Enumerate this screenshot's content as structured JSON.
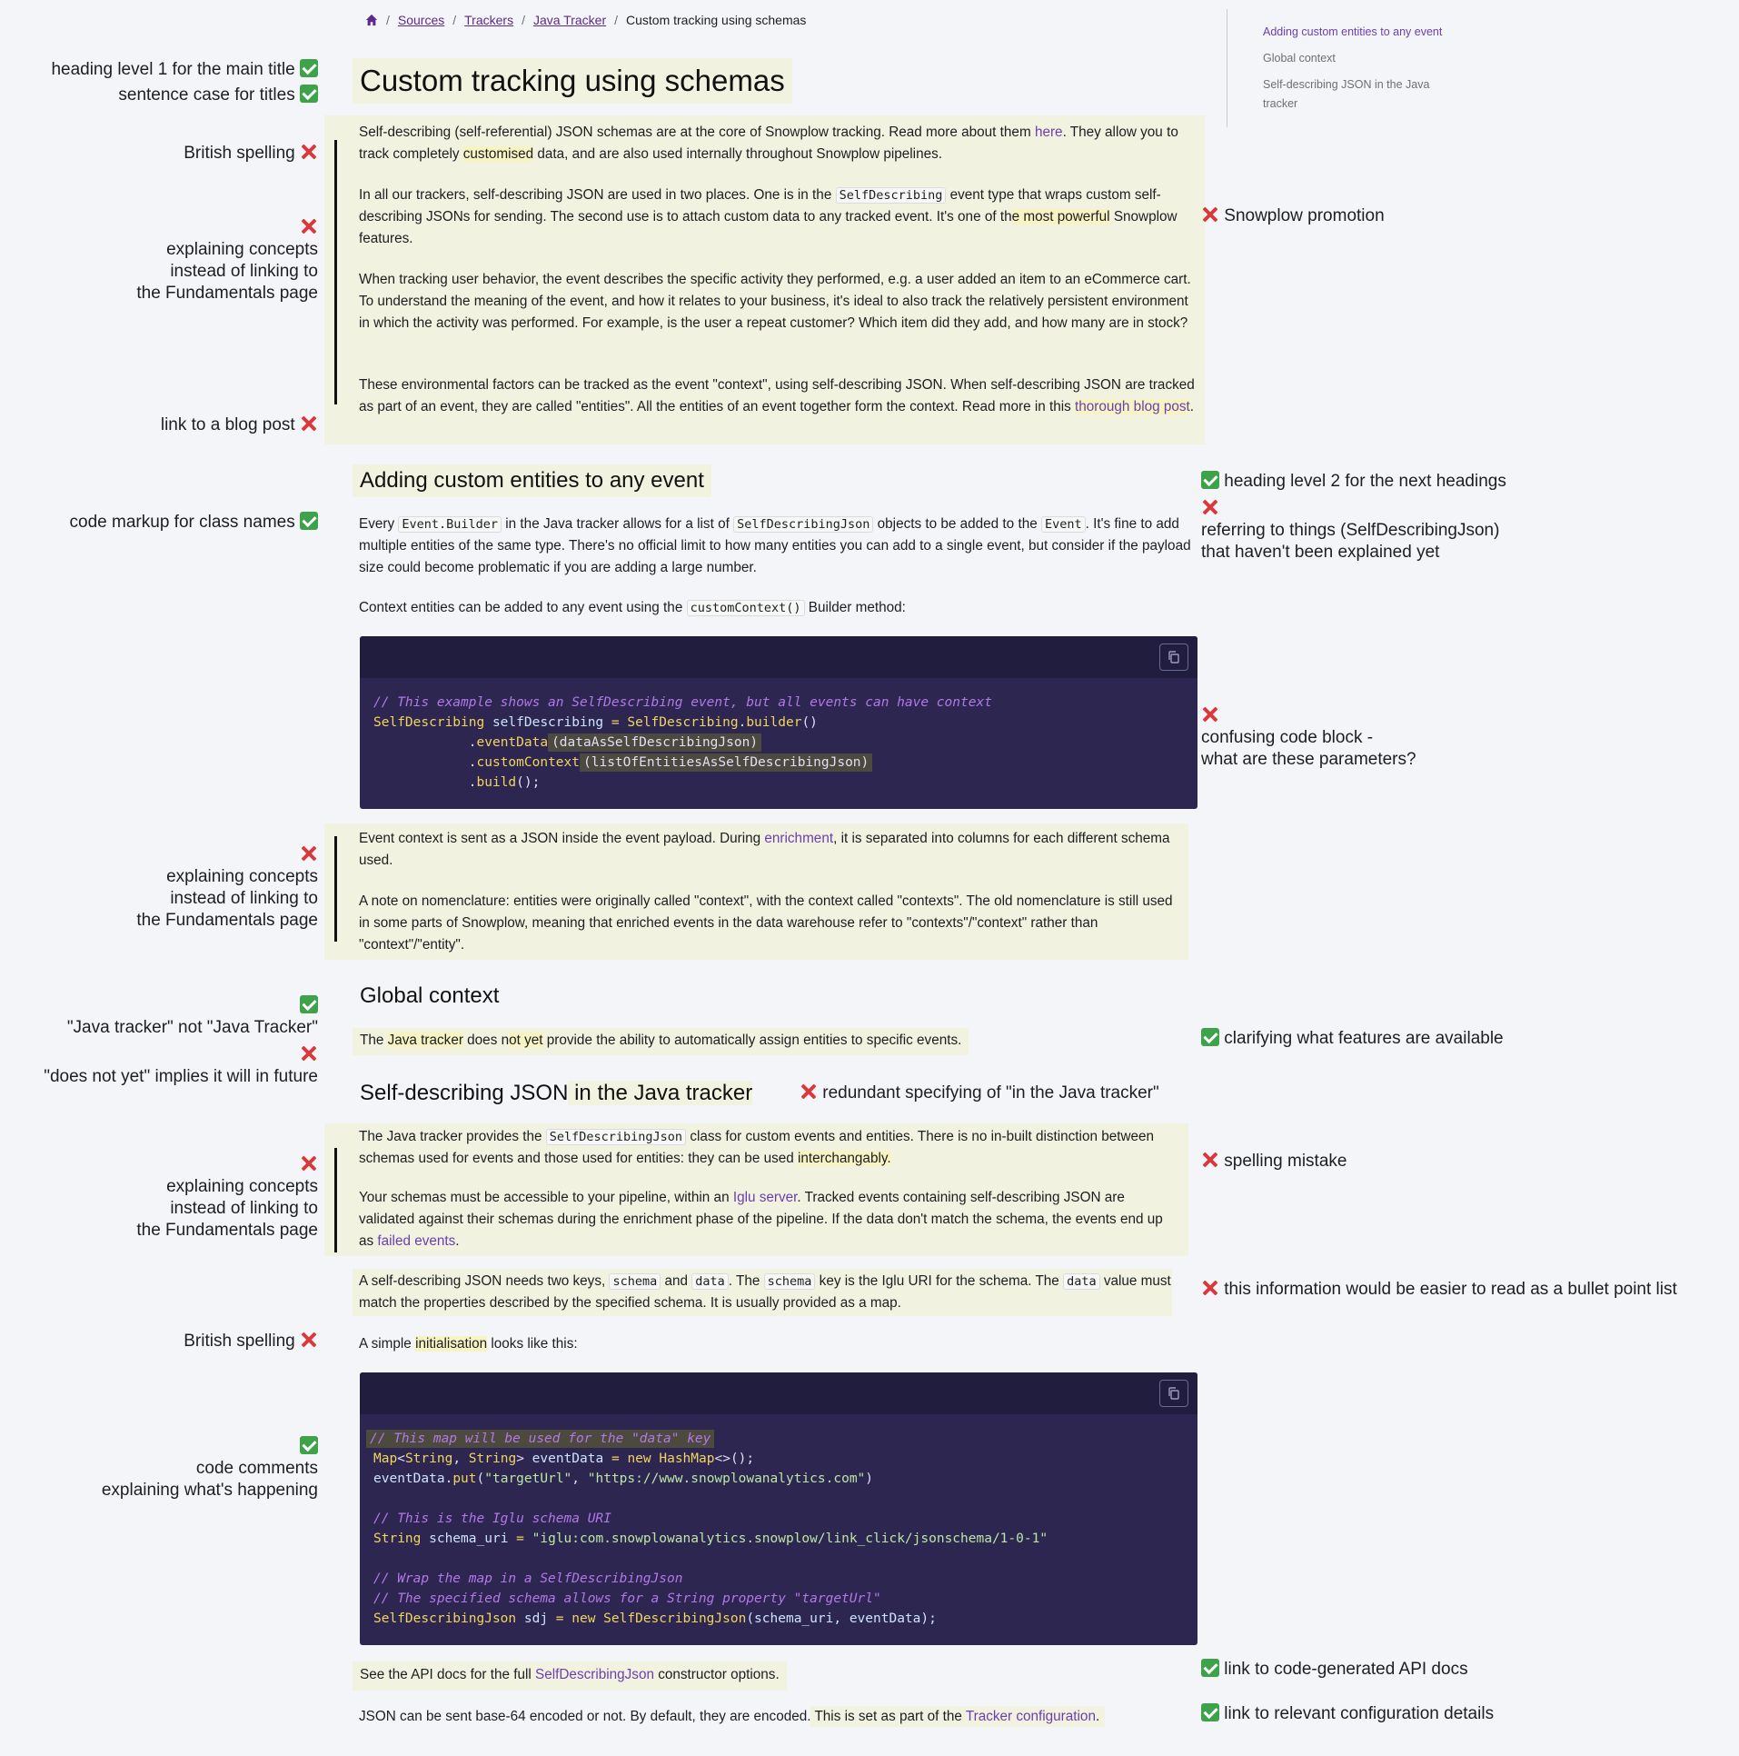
{
  "breadcrumb": {
    "items": [
      "Sources",
      "Trackers",
      "Java Tracker"
    ],
    "current": "Custom tracking using schemas"
  },
  "toc": {
    "items": [
      "Adding custom entities to any event",
      "Global context",
      "Self-describing JSON in the Java tracker"
    ]
  },
  "page": {
    "title": "Custom tracking using schemas",
    "intro": {
      "p1_a": "Self-describing (self-referential) JSON schemas are at the core of Snowplow tracking. Read more about them ",
      "p1_link": "here",
      "p1_b": ". They allow you to track completely ",
      "p1_hl": "customised",
      "p1_c": " data, and are also used internally throughout Snowplow pipelines.",
      "p2_a": "In all our trackers, self-describing JSON are used in two places. One is in the ",
      "p2_code": "SelfDescribing",
      "p2_b": " event type that wraps custom self-describing JSONs for sending. The second use is to attach custom data to any tracked event. It's one of th",
      "p2_hl": "e most powerful",
      "p2_c": " Snowplow features.",
      "p3": "When tracking user behavior, the event describes the specific activity they performed, e.g. a user added an item to an eCommerce cart. To understand the meaning of the event, and how it relates to your business, it's ideal to also track the relatively persistent environment in which the activity was performed. For example, is the user a repeat customer? Which item did they add, and how many are in stock?",
      "p4_a": "These environmental factors can be tracked as the event \"context\", using self-describing JSON. When self-describing JSON are tracked as part of an event, they are called \"entities\". All the entities of an event together form the context. Read more in this ",
      "p4_link": "thorough blog post",
      "p4_b": "."
    },
    "section1": {
      "heading": "Adding custom entities to any event",
      "p1_a": "Every ",
      "p1_code1": "Event.Builder",
      "p1_b": " in the Java tracker allows for a list of ",
      "p1_code2": "SelfDescribingJson",
      "p1_c": " objects to be added to the ",
      "p1_code3": "Event",
      "p1_d": ". It's fine to add multiple entities of the same type. There's no official limit to how many entities you can add to a single event, but consider if the payload size could become problematic if you are adding a large number.",
      "p2_a": "Context entities can be added to any event using the ",
      "p2_code": "customContext()",
      "p2_b": " Builder method:",
      "code": {
        "comment": "// This example shows an SelfDescribing event, but all events can have context",
        "l2_type": "SelfDescribing",
        "l2_var": " selfDescribing ",
        "l2_eq": "=",
        "l2_cls": " SelfDescribing",
        "l2_dot": ".",
        "l2_fn": "builder",
        "l2_end": "()",
        "l3_indent": "            .",
        "l3_fn": "eventData",
        "l3_arg": "(dataAsSelfDescribingJson)",
        "l4_indent": "            .",
        "l4_fn": "customContext",
        "l4_arg": "(listOfEntitiesAsSelfDescribingJson)",
        "l5_indent": "            .",
        "l5_fn": "build",
        "l5_end": "();"
      },
      "p3_a": "Event context is sent as a JSON inside the event payload. During ",
      "p3_link": "enrichment",
      "p3_b": ", it is separated into columns for each different schema used.",
      "p4": "A note on nomenclature: entities were originally called \"context\", with the context called \"contexts\". The old nomenclature is still used in some parts of Snowplow, meaning that enriched events in the data warehouse refer to \"contexts\"/\"context\" rather than \"context\"/\"entity\"."
    },
    "section2": {
      "heading": "Global context",
      "p1_a": "The ",
      "p1_hl1": "Java tracker",
      "p1_b": " does n",
      "p1_hl2": "ot yet",
      "p1_c": " provide the ability to automatically assign entities to specific events."
    },
    "section3": {
      "heading_a": "Self-describing JSON",
      "heading_b": " in the Java tracker",
      "p1_a": "The Java tracker provides the ",
      "p1_code": "SelfDescribingJson",
      "p1_b": " class for custom events and entities. There is no in-built distinction between schemas used for events and those used for entities: they can be used ",
      "p1_hl": "interchangably.",
      "p2_a": "Your schemas must be accessible to your pipeline, within an ",
      "p2_link": "Iglu server",
      "p2_b": ". Tracked events containing self-describing JSON are validated against their schemas during the enrichment phase of the pipeline. If the data don't match the schema, the events end up as ",
      "p2_link2": "failed events",
      "p2_c": ".",
      "p3_a": "A self-describing JSON needs two keys, ",
      "p3_code1": "schema",
      "p3_b": " and ",
      "p3_code2": "data",
      "p3_c": ". The ",
      "p3_code3": "schema",
      "p3_d": " key is the Iglu URI for the schema. The ",
      "p3_code4": "data",
      "p3_e": " value must match the properties described by the specified schema. It is usually provided as a map.",
      "p4_a": "A simple ",
      "p4_hl": "initialisation",
      "p4_b": " looks like this:",
      "code": {
        "c1": "// This map will be used for the \"data\" key",
        "l2_a": "Map",
        "l2_b": "<",
        "l2_c": "String",
        "l2_d": ", ",
        "l2_e": "String",
        "l2_f": "> ",
        "l2_g": "eventData",
        "l2_h": " = ",
        "l2_i": "new",
        "l2_j": " HashMap",
        "l2_k": "<>();",
        "l3_a": "eventData",
        "l3_b": ".",
        "l3_c": "put",
        "l3_d": "(",
        "l3_e": "\"targetUrl\"",
        "l3_f": ", ",
        "l3_g": "\"https://www.snowplowanalytics.com\"",
        "l3_h": ")",
        "c2": "// This is the Iglu schema URI",
        "l5_a": "String",
        "l5_b": " schema_uri ",
        "l5_c": "=",
        "l5_d": " ",
        "l5_e": "\"iglu:com.snowplowanalytics.snowplow/link_click/jsonschema/1-0-1\"",
        "c3": "// Wrap the map in a SelfDescribingJson",
        "c4": "// The specified schema allows for a String property \"targetUrl\"",
        "l8_a": "SelfDescribingJson",
        "l8_b": " sdj ",
        "l8_c": "=",
        "l8_d": " new",
        "l8_e": " SelfDescribingJson",
        "l8_f": "(schema_uri, eventData);"
      },
      "p5_a": "See the API docs for the full ",
      "p5_link": "SelfDescribingJson",
      "p5_b": " constructor options.",
      "p6_a": "JSON can be sent base-64 encoded or not. By default, they are encoded.",
      "p6_b": " This is set as part of the ",
      "p6_link": "Tracker configuration",
      "p6_c": "."
    }
  },
  "annotations": {
    "left": {
      "h1_level": "heading level 1 for the main title",
      "sentence_case": "sentence case for titles",
      "british1": "British spelling",
      "explain1": [
        "explaining concepts",
        "instead of linking to",
        "the Fundamentals page"
      ],
      "blog": "link to a blog post",
      "code_markup": "code markup for class names",
      "explain2": [
        "explaining concepts",
        "instead of linking to",
        "the Fundamentals page"
      ],
      "java_tracker": "\"Java tracker\" not \"Java Tracker\"",
      "does_not_yet": "\"does not yet\" implies it will in future",
      "explain3": [
        "explaining concepts",
        "instead of linking to",
        "the Fundamentals page"
      ],
      "british2": "British spelling",
      "code_comments": [
        "code comments",
        "explaining what's happening"
      ]
    },
    "right": {
      "promotion": "Snowplow promotion",
      "h2_level": "heading level 2 for the next headings",
      "referring": [
        "referring to things (SelfDescribingJson)",
        "that haven't been explained yet"
      ],
      "confusing": [
        "confusing code block -",
        "what are these parameters?"
      ],
      "clarifying": "clarifying what features are available",
      "redundant": "redundant specifying of \"in the Java tracker\"",
      "spelling": "spelling mistake",
      "bullets": "this information would be easier to read as a bullet point list",
      "api_docs": "link to code-generated API docs",
      "config": "link to relevant configuration details"
    }
  }
}
